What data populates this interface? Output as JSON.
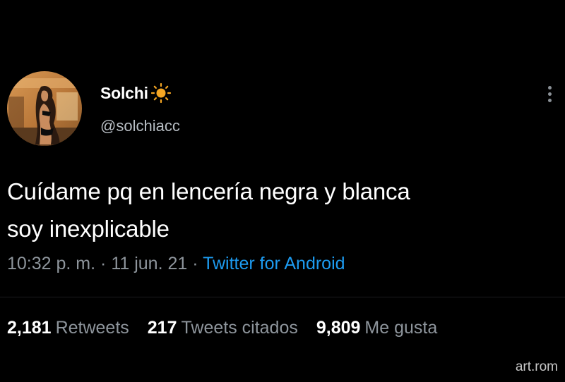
{
  "tweet": {
    "author": {
      "display_name": "Solchi",
      "name_emoji": "sun-icon",
      "handle": "@solchiacc"
    },
    "text_line1": "Cuídame pq en lencería negra y blanca",
    "text_line2": "soy inexplicable",
    "time": "10:32 p. m.",
    "separator": "·",
    "date": "11 jun. 21",
    "source": "Twitter for Android",
    "stats": {
      "retweets_count": "2,181",
      "retweets_label": "Retweets",
      "quotes_count": "217",
      "quotes_label": "Tweets citados",
      "likes_count": "9,809",
      "likes_label": "Me gusta"
    }
  },
  "watermark": "art.rom",
  "colors": {
    "background": "#000000",
    "link": "#1d9bf0",
    "secondary_text": "#8e959c",
    "sun": "#f5a623"
  }
}
